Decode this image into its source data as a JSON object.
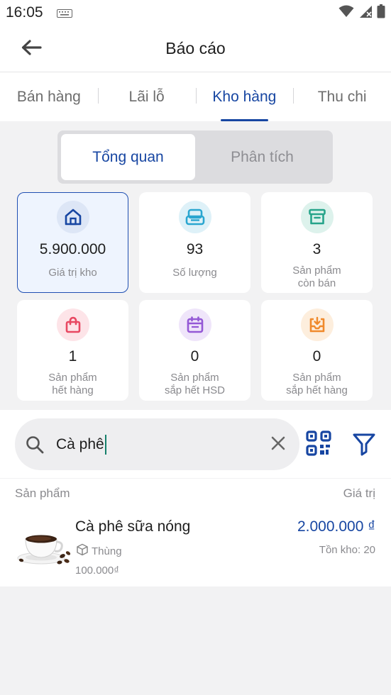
{
  "status_bar": {
    "time": "16:05",
    "icons": [
      "keyboard-icon",
      "wifi-icon",
      "signal-icon",
      "battery-icon"
    ]
  },
  "header": {
    "title": "Báo cáo",
    "back_icon": "arrow-left-icon"
  },
  "tabs": [
    {
      "label": "Bán hàng",
      "active": false
    },
    {
      "label": "Lãi lỗ",
      "active": false
    },
    {
      "label": "Kho hàng",
      "active": true
    },
    {
      "label": "Thu chi",
      "active": false
    }
  ],
  "segment": {
    "options": [
      "Tổng quan",
      "Phân tích"
    ],
    "selected": "Tổng quan"
  },
  "cards": [
    {
      "value": "5.900.000",
      "label": "Giá trị kho",
      "icon": "warehouse-icon",
      "color": "#1746a2",
      "bg": "#dde6f6",
      "selected": true
    },
    {
      "value": "93",
      "label": "Số lượng",
      "icon": "stack-icon",
      "color": "#2aa6d0",
      "bg": "#def1f8"
    },
    {
      "value": "3",
      "label": "Sản phẩm\ncòn bán",
      "icon": "archive-icon",
      "color": "#26a48a",
      "bg": "#ddf2ec"
    },
    {
      "value": "1",
      "label": "Sản phẩm\nhết hàng",
      "icon": "shopping-bag-icon",
      "color": "#e84862",
      "bg": "#fde4e8"
    },
    {
      "value": "0",
      "label": "Sản phẩm\nsắp hết HSD",
      "icon": "calendar-icon",
      "color": "#9458d6",
      "bg": "#efe5fa"
    },
    {
      "value": "0",
      "label": "Sản phẩm\nsắp hết hàng",
      "icon": "inbox-download-icon",
      "color": "#f08a2c",
      "bg": "#fdeedd"
    }
  ],
  "search": {
    "value": "Cà phê",
    "icons": [
      "search-icon",
      "clear-icon",
      "qr-code-icon",
      "filter-icon"
    ]
  },
  "list": {
    "col_product": "Sản phẩm",
    "col_value": "Giá trị",
    "items": [
      {
        "name": "Cà phê sữa nóng",
        "unit": "Thùng",
        "price": "100.000₫",
        "value": "2.000.000 ₫",
        "stock": "Tồn kho: 20"
      }
    ]
  },
  "colors": {
    "accent": "#1746a2",
    "background": "#f2f2f3",
    "card_selected_bg": "#eef4fe"
  }
}
